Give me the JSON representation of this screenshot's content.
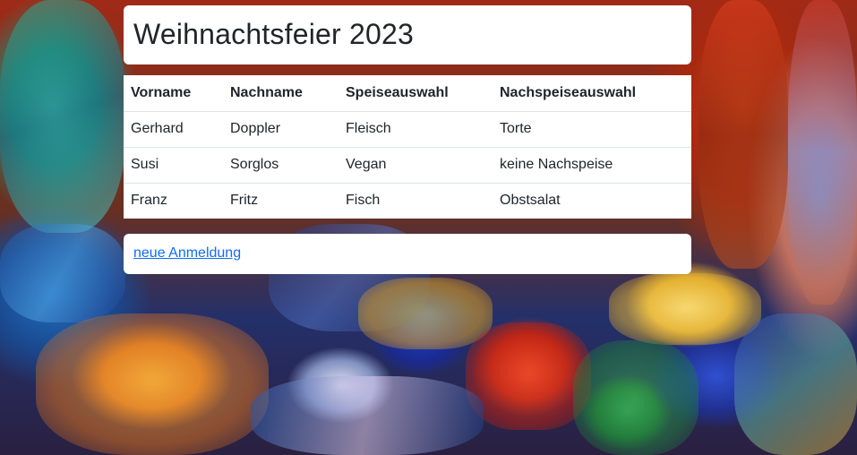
{
  "page": {
    "title": "Weihnachtsfeier 2023"
  },
  "table": {
    "headers": [
      "Vorname",
      "Nachname",
      "Speiseauswahl",
      "Nachspeiseauswahl"
    ],
    "rows": [
      [
        "Gerhard",
        "Doppler",
        "Fleisch",
        "Torte"
      ],
      [
        "Susi",
        "Sorglos",
        "Vegan",
        "keine Nachspeise"
      ],
      [
        "Franz",
        "Fritz",
        "Fisch",
        "Obstsalat"
      ]
    ]
  },
  "actions": {
    "new_registration_label": "neue Anmeldung"
  },
  "colors": {
    "link": "#0d6efd",
    "card_background": "#ffffff",
    "text": "#212529",
    "row_border": "#dee2e6"
  },
  "background": {
    "description_icon": "painted-food-background-image"
  }
}
